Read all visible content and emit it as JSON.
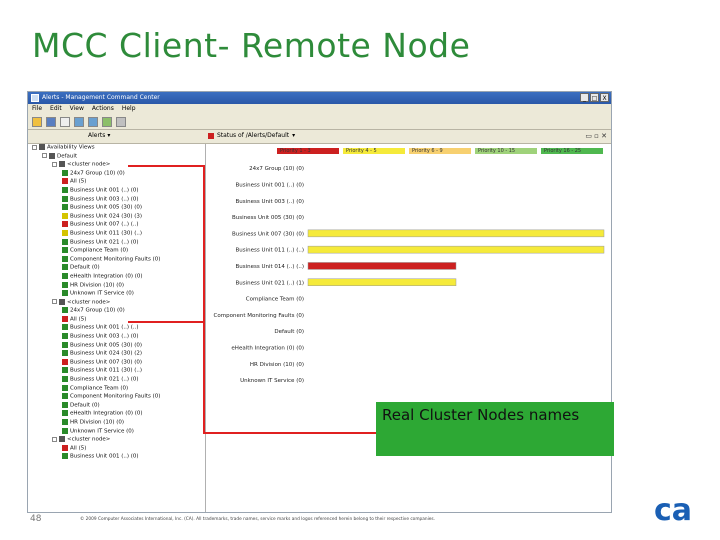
{
  "slide": {
    "title": "MCC Client- Remote Node",
    "page_number": "48",
    "copyright": "© 2009 Computer Associates International, Inc. (CA). All trademarks, trade names, service marks and logos referenced herein belong to their respective companies.",
    "callout_text": "Real Cluster Nodes names",
    "logo": "ca",
    "callout_color": "#2da834",
    "arrow_color": "#e02020"
  },
  "window": {
    "title": "Alerts - Management Command Center",
    "menu": [
      "File",
      "Edit",
      "View",
      "Actions",
      "Help"
    ],
    "controls": [
      "_",
      "□",
      "X"
    ]
  },
  "left_pane": {
    "header": "Alerts",
    "tree": [
      {
        "label": "Availability Views",
        "level": 0,
        "color": "#555555"
      },
      {
        "label": "Default",
        "level": 1,
        "color": "#555555"
      },
      {
        "label": "<cluster node>",
        "level": 2,
        "color": "#555555"
      },
      {
        "label": "24x7 Group (10) (0)",
        "level": 3,
        "color": "#2a8a2a"
      },
      {
        "label": "All (5)",
        "level": 3,
        "color": "#cc2020"
      },
      {
        "label": "Business Unit 001 (..) (0)",
        "level": 3,
        "color": "#2a8a2a"
      },
      {
        "label": "Business Unit 003 (..) (0)",
        "level": 3,
        "color": "#2a8a2a"
      },
      {
        "label": "Business Unit 005 (30) (0)",
        "level": 3,
        "color": "#2a8a2a"
      },
      {
        "label": "Business Unit 024 (30) (3)",
        "level": 3,
        "color": "#d4c400"
      },
      {
        "label": "Business Unit 007 (..) (..)",
        "level": 3,
        "color": "#cc2020"
      },
      {
        "label": "Business Unit 011 (30) (..)",
        "level": 3,
        "color": "#d4c400"
      },
      {
        "label": "Business Unit 021 (..) (0)",
        "level": 3,
        "color": "#2a8a2a"
      },
      {
        "label": "Compliance Team (0)",
        "level": 3,
        "color": "#2a8a2a"
      },
      {
        "label": "Component Monitoring Faults (0)",
        "level": 3,
        "color": "#2a8a2a"
      },
      {
        "label": "Default (0)",
        "level": 3,
        "color": "#2a8a2a"
      },
      {
        "label": "eHealth Integration (0) (0)",
        "level": 3,
        "color": "#2a8a2a"
      },
      {
        "label": "HR Division (10) (0)",
        "level": 3,
        "color": "#2a8a2a"
      },
      {
        "label": "Unknown IT Service (0)",
        "level": 3,
        "color": "#2a8a2a"
      },
      {
        "label": "<cluster node>",
        "level": 2,
        "color": "#555555"
      },
      {
        "label": "24x7 Group (10) (0)",
        "level": 3,
        "color": "#2a8a2a"
      },
      {
        "label": "All (5)",
        "level": 3,
        "color": "#cc2020"
      },
      {
        "label": "Business Unit 001 (..) (..)",
        "level": 3,
        "color": "#2a8a2a"
      },
      {
        "label": "Business Unit 003 (..) (0)",
        "level": 3,
        "color": "#2a8a2a"
      },
      {
        "label": "Business Unit 005 (30) (0)",
        "level": 3,
        "color": "#2a8a2a"
      },
      {
        "label": "Business Unit 024 (30) (2)",
        "level": 3,
        "color": "#2a8a2a"
      },
      {
        "label": "Business Unit 007 (30) (0)",
        "level": 3,
        "color": "#cc2020"
      },
      {
        "label": "Business Unit 011 (30) (..)",
        "level": 3,
        "color": "#2a8a2a"
      },
      {
        "label": "Business Unit 021 (..) (0)",
        "level": 3,
        "color": "#2a8a2a"
      },
      {
        "label": "Compliance Team (0)",
        "level": 3,
        "color": "#2a8a2a"
      },
      {
        "label": "Component Monitoring Faults (0)",
        "level": 3,
        "color": "#2a8a2a"
      },
      {
        "label": "Default (0)",
        "level": 3,
        "color": "#2a8a2a"
      },
      {
        "label": "eHealth Integration (0) (0)",
        "level": 3,
        "color": "#2a8a2a"
      },
      {
        "label": "HR Division (10) (0)",
        "level": 3,
        "color": "#2a8a2a"
      },
      {
        "label": "Unknown IT Service (0)",
        "level": 3,
        "color": "#2a8a2a"
      },
      {
        "label": "<cluster node>",
        "level": 2,
        "color": "#555555"
      },
      {
        "label": "All (5)",
        "level": 3,
        "color": "#cc2020"
      },
      {
        "label": "Business Unit 001 (..) (0)",
        "level": 3,
        "color": "#2a8a2a"
      }
    ]
  },
  "right_pane": {
    "header": "Status of /Alerts/Default",
    "chart_data": {
      "type": "bar",
      "orientation": "horizontal",
      "legend": [
        {
          "label": "Priority 1 - 3",
          "color": "#cc2020"
        },
        {
          "label": "Priority 4 - 5",
          "color": "#f5ea3a"
        },
        {
          "label": "Priority 6 - 9",
          "color": "#f7d070"
        },
        {
          "label": "Priority 10 - 15",
          "color": "#9fd27a"
        },
        {
          "label": "Priority 16 - 25",
          "color": "#4fb84f"
        }
      ],
      "categories": [
        "24x7 Group (10) (0)",
        "Business Unit 001 (..) (0)",
        "Business Unit 003 (..) (0)",
        "Business Unit 005 (30) (0)",
        "Business Unit 007 (30) (0)",
        "Business Unit 011 (..) (..)",
        "Business Unit 014 (..) (..)",
        "Business Unit 021 (..) (1)",
        "Compliance Team (0)",
        "Component Monitoring Faults (0)",
        "Default (0)",
        "eHealth Integration (0) (0)",
        "HR Division (10) (0)",
        "Unknown IT Service (0)"
      ],
      "series": [
        {
          "name": "Priority 1 - 3",
          "values": [
            0,
            0,
            0,
            0,
            0,
            0,
            1,
            0,
            0,
            0,
            0,
            0,
            0,
            0
          ]
        },
        {
          "name": "Priority 4 - 5",
          "values": [
            0,
            0,
            0,
            0,
            1,
            1,
            0,
            1,
            0,
            0,
            0,
            0,
            0,
            0
          ]
        }
      ],
      "bar_extent": [
        0,
        0,
        0,
        0,
        1.0,
        1.0,
        0.5,
        0.5,
        0,
        0,
        0,
        0,
        0,
        0
      ],
      "grid": false,
      "legend_position": "top"
    }
  }
}
